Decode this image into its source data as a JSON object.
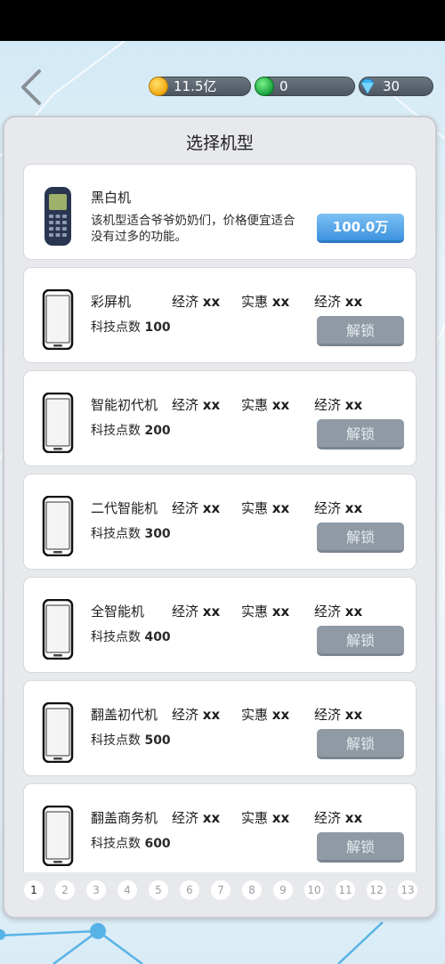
{
  "header": {
    "resources": {
      "gold": "11.5亿",
      "green": "0",
      "diamond": "30"
    }
  },
  "panel": {
    "title": "选择机型",
    "featured": {
      "name": "黑白机",
      "description": "该机型适合爷爷奶奶们，价格便宜适合没有过多的功能。",
      "price": "100.0万"
    },
    "stat_labels": [
      "经济",
      "实惠",
      "经济"
    ],
    "stat_value": "xx",
    "tech_label": "科技点数",
    "unlock_label": "解锁",
    "models": [
      {
        "name": "彩屏机",
        "tech": "100"
      },
      {
        "name": "智能初代机",
        "tech": "200"
      },
      {
        "name": "二代智能机",
        "tech": "300"
      },
      {
        "name": "全智能机",
        "tech": "400"
      },
      {
        "name": "翻盖初代机",
        "tech": "500"
      },
      {
        "name": "翻盖商务机",
        "tech": "600"
      }
    ]
  },
  "pager": {
    "pages": [
      "1",
      "2",
      "3",
      "4",
      "5",
      "6",
      "7",
      "8",
      "9",
      "10",
      "11",
      "12",
      "13"
    ],
    "current": "1"
  }
}
